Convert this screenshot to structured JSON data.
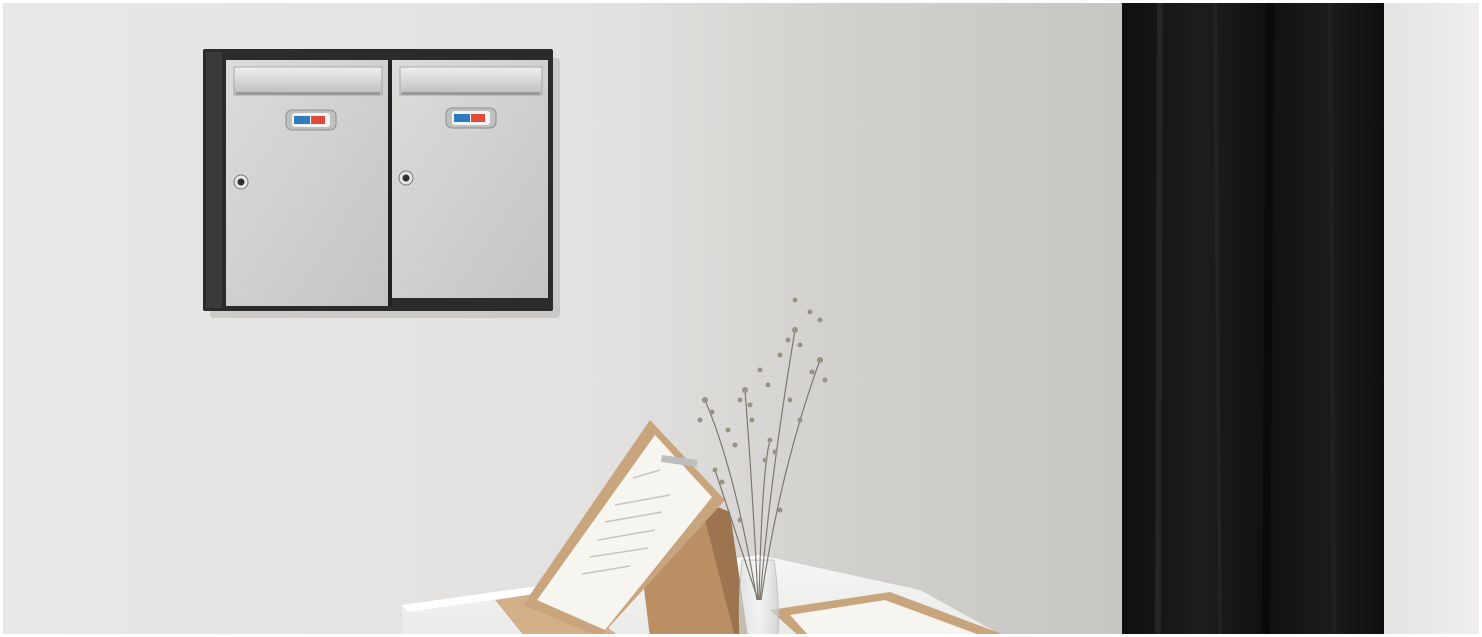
{
  "image": {
    "alt": "",
    "objects": [
      "wall",
      "mailbox-unit",
      "mailbox-door-left",
      "mailbox-door-right",
      "black-curtain",
      "table",
      "wooden-easel",
      "menu-card",
      "glass-vase",
      "dried-flowers",
      "tray"
    ]
  },
  "palette": {
    "wall_light": "#e7e6e4",
    "wall_shadow": "#cfcdca",
    "frame_dark": "#2b2b2b",
    "steel": "#cfd0cf",
    "curtain": "#151515",
    "table": "#f2f2f0",
    "wood": "#c9a57e",
    "paper": "#f7f5f0"
  },
  "mailbox": {
    "doors": 2,
    "label_text": ""
  }
}
